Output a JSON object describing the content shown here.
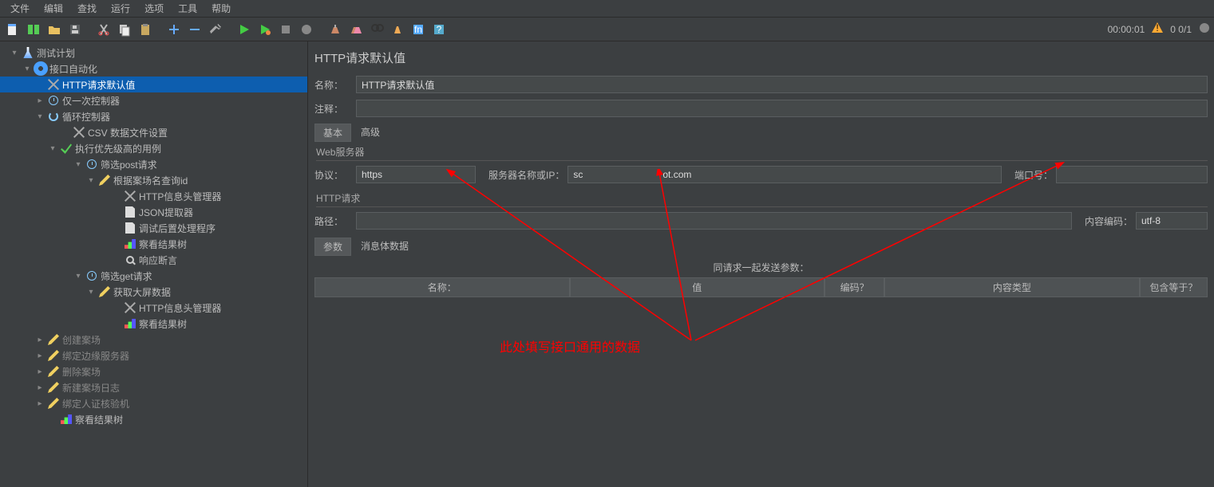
{
  "menu": [
    "文件",
    "编辑",
    "查找",
    "运行",
    "选项",
    "工具",
    "帮助"
  ],
  "status": {
    "time": "00:00:01",
    "counts": "0  0/1"
  },
  "tree": [
    {
      "indent": 12,
      "exp": "▾",
      "icon": "flask",
      "label": "测试计划"
    },
    {
      "indent": 28,
      "exp": "▾",
      "icon": "gear",
      "label": "接口自动化"
    },
    {
      "indent": 44,
      "exp": "",
      "icon": "x",
      "label": "HTTP请求默认值",
      "selected": true
    },
    {
      "indent": 44,
      "exp": "▸",
      "icon": "clock",
      "label": "仅一次控制器"
    },
    {
      "indent": 44,
      "exp": "▾",
      "icon": "loop",
      "label": "循环控制器"
    },
    {
      "indent": 76,
      "exp": "",
      "icon": "x",
      "label": "CSV 数据文件设置"
    },
    {
      "indent": 60,
      "exp": "▾",
      "icon": "tick",
      "label": "执行优先级高的用例"
    },
    {
      "indent": 92,
      "exp": "▾",
      "icon": "clock",
      "label": "筛选post请求"
    },
    {
      "indent": 108,
      "exp": "▾",
      "icon": "pencil",
      "label": "根据案场名查询id"
    },
    {
      "indent": 140,
      "exp": "",
      "icon": "x",
      "label": "HTTP信息头管理器"
    },
    {
      "indent": 140,
      "exp": "",
      "icon": "doc",
      "label": "JSON提取器"
    },
    {
      "indent": 140,
      "exp": "",
      "icon": "doc",
      "label": "调试后置处理程序"
    },
    {
      "indent": 140,
      "exp": "",
      "icon": "chart",
      "label": "察看结果树"
    },
    {
      "indent": 140,
      "exp": "",
      "icon": "zoom",
      "label": "响应断言"
    },
    {
      "indent": 92,
      "exp": "▾",
      "icon": "clock",
      "label": "筛选get请求"
    },
    {
      "indent": 108,
      "exp": "▾",
      "icon": "pencil",
      "label": "获取大屏数据"
    },
    {
      "indent": 140,
      "exp": "",
      "icon": "x",
      "label": "HTTP信息头管理器"
    },
    {
      "indent": 140,
      "exp": "",
      "icon": "chart",
      "label": "察看结果树"
    },
    {
      "indent": 44,
      "exp": "▸",
      "icon": "pencil",
      "label": "创建案场",
      "dim": true
    },
    {
      "indent": 44,
      "exp": "▸",
      "icon": "pencil",
      "label": "绑定边缘服务器",
      "dim": true
    },
    {
      "indent": 44,
      "exp": "▸",
      "icon": "pencil",
      "label": "删除案场",
      "dim": true
    },
    {
      "indent": 44,
      "exp": "▸",
      "icon": "pencil",
      "label": "新建案场日志",
      "dim": true
    },
    {
      "indent": 44,
      "exp": "▸",
      "icon": "pencil",
      "label": "绑定人证核验机",
      "dim": true
    },
    {
      "indent": 60,
      "exp": "",
      "icon": "chart",
      "label": "察看结果树"
    }
  ],
  "panel": {
    "title": "HTTP请求默认值",
    "name_label": "名称：",
    "name_value": "HTTP请求默认值",
    "comment_label": "注释：",
    "comment_value": "",
    "tab_basic": "基本",
    "tab_advanced": "高级",
    "web_server_label": "Web服务器",
    "protocol_label": "协议：",
    "protocol_value": "https",
    "server_label": "服务器名称或IP：",
    "server_value": "sc                              ot.com",
    "port_label": "端口号：",
    "port_value": "",
    "http_request_label": "HTTP请求",
    "path_label": "路径：",
    "path_value": "",
    "encoding_label": "内容编码：",
    "encoding_value": "utf-8",
    "params_tab": "参数",
    "body_tab": "消息体数据",
    "params_header": "同请求一起发送参数：",
    "col_name": "名称：",
    "col_value": "值",
    "col_encode": "编码？",
    "col_type": "内容类型",
    "col_include": "包含等于？"
  },
  "annotation": "此处填写接口通用的数据"
}
